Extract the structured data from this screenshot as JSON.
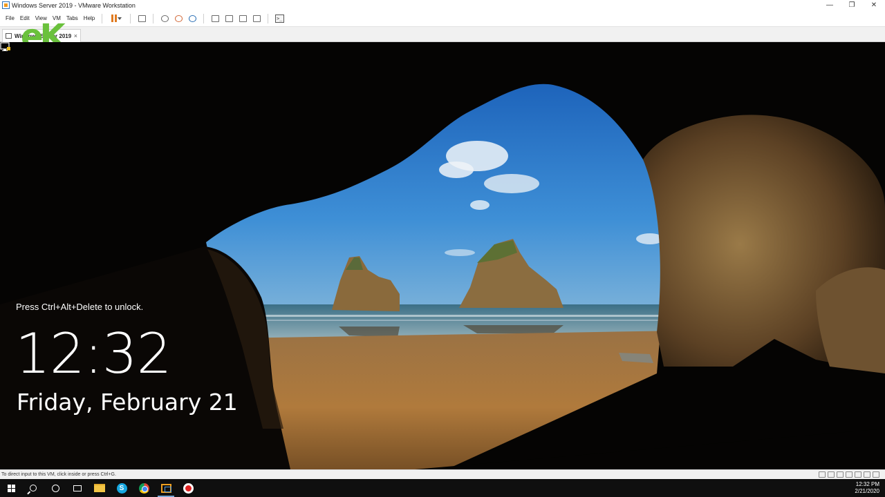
{
  "window": {
    "title": "Windows Server 2019 - VMware Workstation",
    "controls": {
      "minimize": "—",
      "restore": "❐",
      "close": "✕"
    }
  },
  "menubar": {
    "items": [
      "File",
      "Edit",
      "View",
      "VM",
      "Tabs",
      "Help"
    ]
  },
  "toolbar": {
    "icons": [
      "pause-icon",
      "send-ctrl-alt-del-icon",
      "snapshot-icon",
      "revert-snapshot-icon",
      "snapshot-manager-icon",
      "show-library-icon",
      "thumbnail-bar-icon",
      "full-screen-icon",
      "unity-icon",
      "console-view-icon"
    ],
    "console_glyph": ">_"
  },
  "tab": {
    "label": "Windows Server 2019",
    "close": "×"
  },
  "overlay_logo": "eK",
  "lockscreen": {
    "message": "Press Ctrl+Alt+Delete to unlock.",
    "time": "12:32",
    "date": "Friday, February 21"
  },
  "statusbar": {
    "text": "To direct input to this VM, click inside or press Ctrl+G."
  },
  "taskbar": {
    "apps": [
      "start-icon",
      "search-icon",
      "cortana-icon",
      "task-view-icon",
      "file-explorer-icon",
      "skype-icon",
      "chrome-icon",
      "vmware-icon",
      "recorder-icon"
    ],
    "skype_letter": "S",
    "clock": {
      "time": "12:32 PM",
      "date": "2/21/2020"
    }
  },
  "colors": {
    "logo": "#6ac13c",
    "sky": "#2f7fd0",
    "sand": "#b07a3c"
  }
}
